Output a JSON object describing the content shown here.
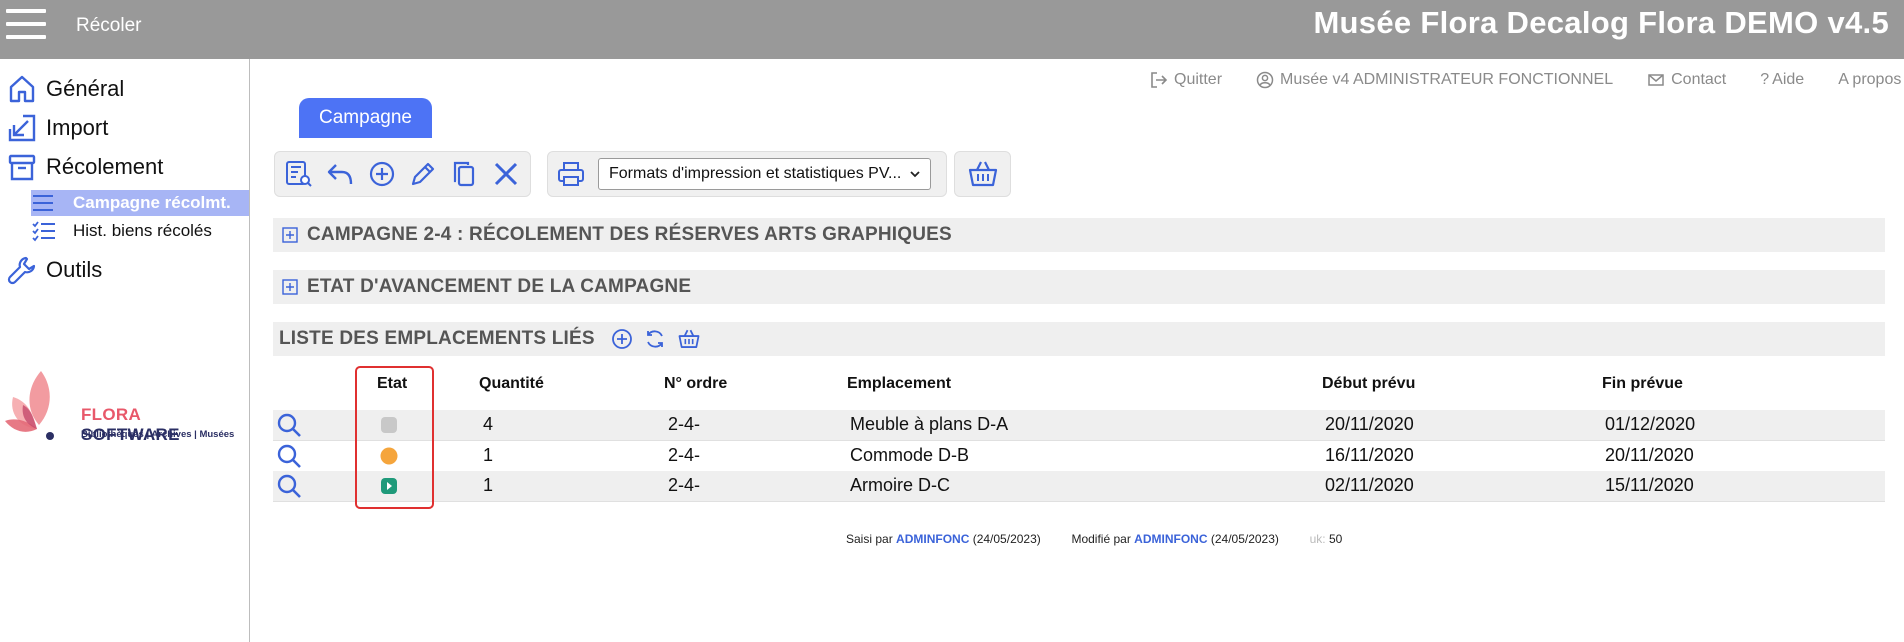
{
  "header": {
    "app_name": "Récoler",
    "title": "Musée Flora Decalog Flora DEMO v4.5"
  },
  "sidebar": {
    "items": [
      {
        "label": "Général",
        "icon": "home-icon"
      },
      {
        "label": "Import",
        "icon": "import-arrow-icon"
      },
      {
        "label": "Récolement",
        "icon": "archive-box-icon"
      },
      {
        "label": "Outils",
        "icon": "wrench-icon"
      }
    ],
    "subitems": [
      {
        "label": "Campagne récolmt.",
        "icon": "list-lines-icon",
        "active": true
      },
      {
        "label": "Hist. biens récolés",
        "icon": "checklist-icon",
        "active": false
      }
    ],
    "logo": {
      "brand_a": "FLORA",
      "brand_b": "SOFTWARE",
      "tagline": "Bibliothèques | Archives | Musées"
    }
  },
  "topnav": {
    "quit": "Quitter",
    "user": "Musée v4 ADMINISTRATEUR FONCTIONNEL",
    "contact": "Contact",
    "help": "Aide",
    "about": "A propos"
  },
  "tab": {
    "label": "Campagne"
  },
  "toolbar": {
    "select_value": "Formats d'impression et statistiques PV..."
  },
  "sections": {
    "campaign": "CAMPAGNE 2-4 : RÉCOLEMENT DES RÉSERVES ARTS GRAPHIQUES",
    "progress": "ETAT D'AVANCEMENT DE LA CAMPAGNE",
    "locations": "LISTE DES EMPLACEMENTS LIÉS"
  },
  "table": {
    "headers": {
      "etat": "Etat",
      "quantite": "Quantité",
      "ordre": "N° ordre",
      "emplacement": "Emplacement",
      "debut": "Début prévu",
      "fin": "Fin prévue"
    },
    "rows": [
      {
        "etat_color": "#c8c8c8",
        "etat_icon": "grey-square-status-icon",
        "quantite": "4",
        "ordre": "2-4-",
        "emplacement": "Meuble à plans D-A",
        "debut": "20/11/2020",
        "fin": "01/12/2020"
      },
      {
        "etat_color": "#f5a53c",
        "etat_icon": "orange-circle-status-icon",
        "quantite": "1",
        "ordre": "2-4-",
        "emplacement": "Commode D-B",
        "debut": "16/11/2020",
        "fin": "20/11/2020"
      },
      {
        "etat_color": "#1f9a7a",
        "etat_icon": "green-play-status-icon",
        "quantite": "1",
        "ordre": "2-4-",
        "emplacement": "Armoire D-C",
        "debut": "02/11/2020",
        "fin": "15/11/2020"
      }
    ]
  },
  "footer": {
    "saisi_label": "Saisi par",
    "saisi_user": "ADMINFONC",
    "saisi_date": "(24/05/2023)",
    "modif_label": "Modifié par",
    "modif_user": "ADMINFONC",
    "modif_date": "(24/05/2023)",
    "uk_label": "uk:",
    "uk_value": "50"
  },
  "colors": {
    "header_bg": "#999999",
    "accent": "#4d73f5",
    "icon_blue": "#3b63d9",
    "active_sub": "#a7b5f5",
    "highlight": "#e03030"
  }
}
